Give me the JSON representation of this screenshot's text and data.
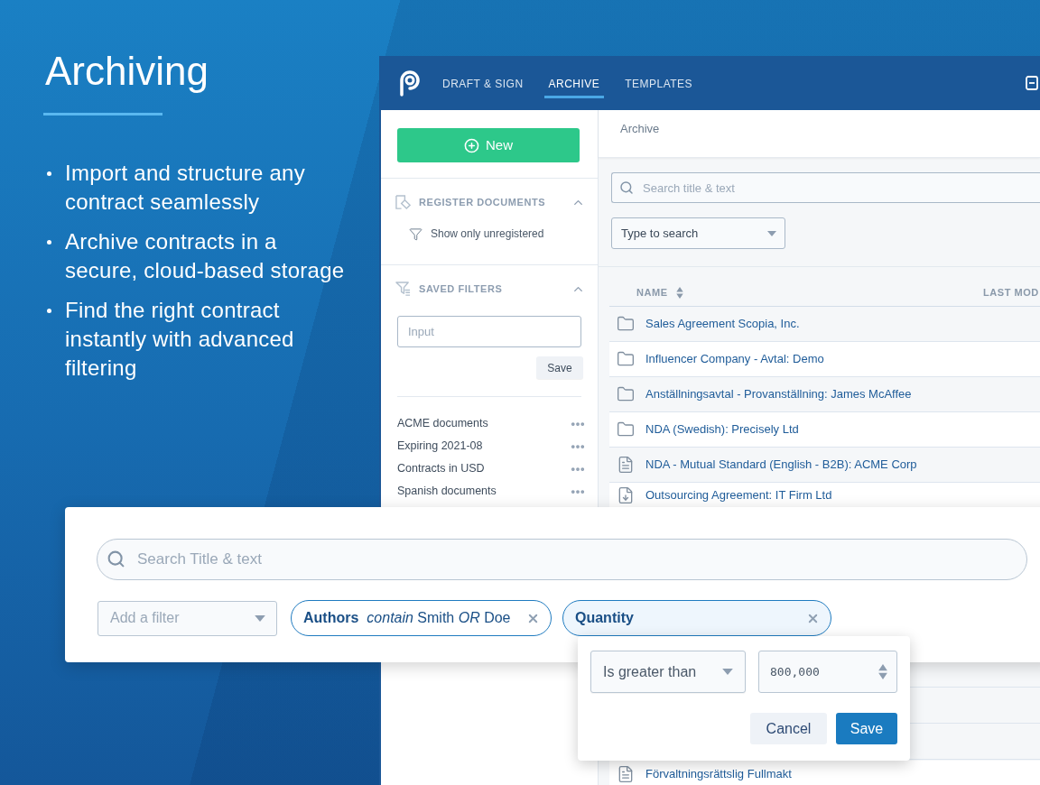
{
  "intro": {
    "title": "Archiving",
    "bullets": [
      "Import and structure any contract seamlessly",
      "Archive contracts in a secure, cloud-based storage",
      "Find the right contract instantly with advanced filtering"
    ]
  },
  "app": {
    "nav": {
      "tabs": [
        {
          "label": "DRAFT & SIGN",
          "selected": false
        },
        {
          "label": "ARCHIVE",
          "selected": true
        },
        {
          "label": "TEMPLATES",
          "selected": false
        }
      ]
    },
    "sidebar": {
      "new_button": "New",
      "sections": [
        {
          "kind": "register",
          "title": "REGISTER DOCUMENTS",
          "expanded": true,
          "items": [
            "Show only unregistered"
          ]
        },
        {
          "kind": "saved_filters",
          "title": "SAVED FILTERS",
          "expanded": true,
          "input": {
            "placeholder": "Input"
          },
          "save_button": "Save",
          "filters": [
            "ACME documents",
            "Expiring 2021-08",
            "Contracts in USD",
            "Spanish documents"
          ]
        }
      ]
    },
    "breadcrumb": "Archive",
    "search": {
      "placeholder": "Search title & text"
    },
    "type_select": {
      "value": "Type to search"
    },
    "table": {
      "columns": [
        "NAME",
        "LAST MOD"
      ],
      "rows": [
        {
          "kind": "folder",
          "name": "Sales Agreement Scopia, Inc."
        },
        {
          "kind": "folder",
          "name": "Influencer Company - Avtal: Demo"
        },
        {
          "kind": "folder",
          "name": "Anställningsavtal - Provanställning: James McAffee"
        },
        {
          "kind": "folder",
          "name": "NDA (Swedish): Precisely Ltd"
        },
        {
          "kind": "document",
          "name": "NDA - Mutual Standard (English - B2B): ACME Corp"
        },
        {
          "kind": "download",
          "name": "Outsourcing Agreement: IT Firm Ltd"
        }
      ],
      "rows_below": [
        {
          "kind": "document",
          "name": "Förvaltningsrättslig Fullmakt"
        }
      ]
    }
  },
  "filter_panel": {
    "search": {
      "placeholder": "Search Title & text"
    },
    "add_filter": {
      "placeholder": "Add a filter"
    },
    "chips": [
      {
        "field": "Authors",
        "condition": "*contain* Smith *OR* Doe",
        "selected": false
      },
      {
        "field": "Quantity",
        "selected": true
      }
    ],
    "popup": {
      "operator": "Is greater than",
      "value": "800,000",
      "buttons": [
        {
          "label": "Cancel",
          "kind": "secondary"
        },
        {
          "label": "Save",
          "kind": "primary"
        }
      ]
    }
  }
}
